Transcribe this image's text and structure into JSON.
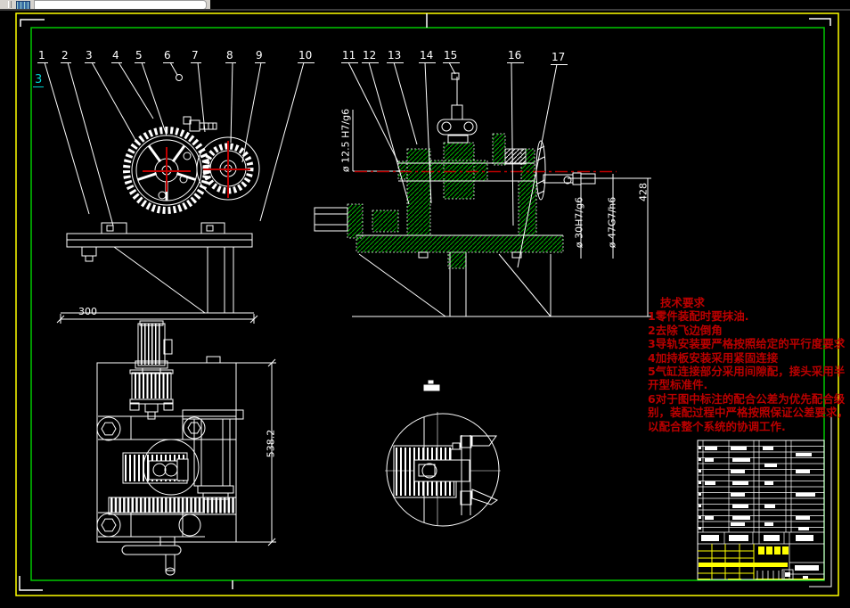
{
  "frame": {
    "view_marker": "3"
  },
  "callouts": [
    "1",
    "2",
    "3",
    "4",
    "5",
    "6",
    "7",
    "8",
    "9",
    "10",
    "11",
    "12",
    "13",
    "14",
    "15",
    "16",
    "17"
  ],
  "dims": {
    "left_width": "300",
    "bl_height": "538.2",
    "right_height": "428",
    "bore": "ø 12.5 H7/g6",
    "shaft30": "ø 30H7/g6",
    "shaft47": "ø 47G7/h6"
  },
  "tech": {
    "title": "技术要求",
    "lines": [
      "1零件装配时要抹油.",
      "2去除飞边倒角",
      "3导轨安装要严格按照给定的平行度要求",
      "4加持板安装采用紧固连接",
      "5气缸连接部分采用间隙配，接头采用半",
      "开型标准件.",
      "6对于图中标注的配合公差为优先配合级",
      "别，装配过程中严格按照保证公差要求，",
      "以配合整个系统的协调工作."
    ]
  },
  "colors": {
    "line": "#ffffff",
    "frame_yellow": "#ffff00",
    "frame_green": "#00c800",
    "hatch_green": "#00b400",
    "accent_red": "#bb0000",
    "marker_cyan": "#00d2d2"
  },
  "icons": {
    "toolbar_icon": "table-grid-icon"
  }
}
